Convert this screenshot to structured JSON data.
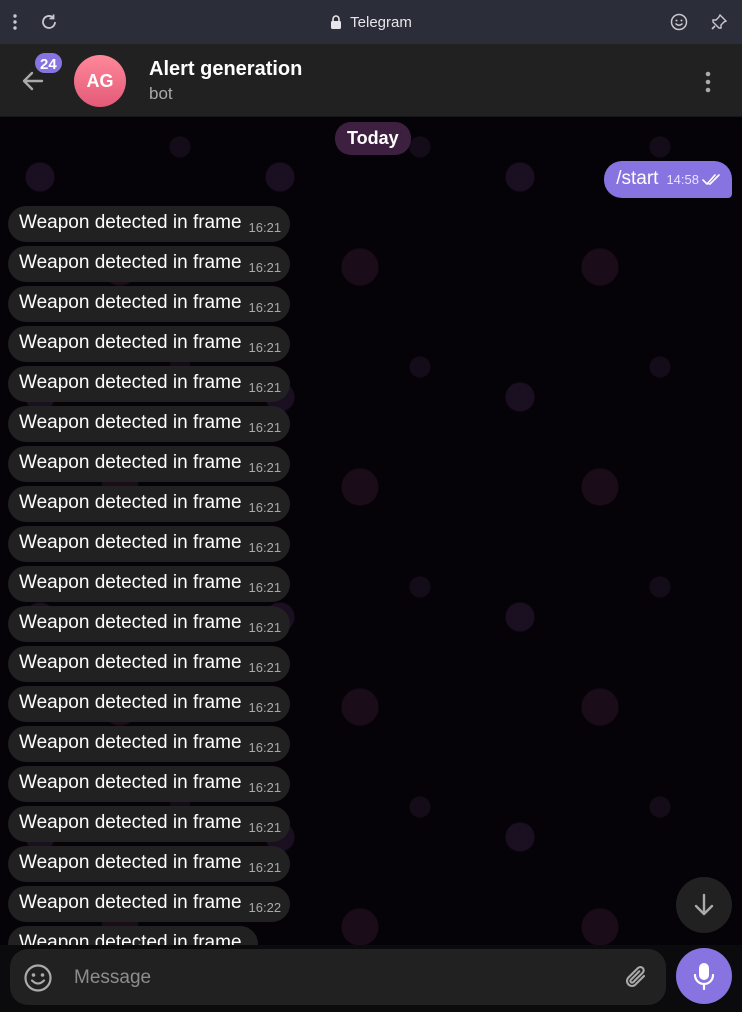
{
  "browser": {
    "title": "Telegram"
  },
  "header": {
    "unread_count": "24",
    "avatar_initials": "AG",
    "title": "Alert generation",
    "subtitle": "bot"
  },
  "chat": {
    "date_separator": "Today",
    "outgoing": {
      "text": "/start",
      "time": "14:58"
    },
    "incoming": [
      {
        "text": "Weapon detected in frame",
        "time": "16:21"
      },
      {
        "text": "Weapon detected in frame",
        "time": "16:21"
      },
      {
        "text": "Weapon detected in frame",
        "time": "16:21"
      },
      {
        "text": "Weapon detected in frame",
        "time": "16:21"
      },
      {
        "text": "Weapon detected in frame",
        "time": "16:21"
      },
      {
        "text": "Weapon detected in frame",
        "time": "16:21"
      },
      {
        "text": "Weapon detected in frame",
        "time": "16:21"
      },
      {
        "text": "Weapon detected in frame",
        "time": "16:21"
      },
      {
        "text": "Weapon detected in frame",
        "time": "16:21"
      },
      {
        "text": "Weapon detected in frame",
        "time": "16:21"
      },
      {
        "text": "Weapon detected in frame",
        "time": "16:21"
      },
      {
        "text": "Weapon detected in frame",
        "time": "16:21"
      },
      {
        "text": "Weapon detected in frame",
        "time": "16:21"
      },
      {
        "text": "Weapon detected in frame",
        "time": "16:21"
      },
      {
        "text": "Weapon detected in frame",
        "time": "16:21"
      },
      {
        "text": "Weapon detected in frame",
        "time": "16:21"
      },
      {
        "text": "Weapon detected in frame",
        "time": "16:21"
      },
      {
        "text": "Weapon detected in frame",
        "time": "16:22"
      },
      {
        "text": "Weapon detected in frame",
        "time": ""
      }
    ]
  },
  "composer": {
    "placeholder": "Message"
  },
  "colors": {
    "accent": "#8774e1",
    "bubble_incoming": "#212121",
    "header_bg": "#212121",
    "date_pill": "#3d2040",
    "avatar_gradient_top": "#ff889a",
    "avatar_gradient_bottom": "#e35a78"
  },
  "icons": {
    "browser_left": [
      "more-vertical-icon",
      "reload-icon"
    ],
    "browser_center": "lock-icon",
    "browser_right": [
      "emoji-icon",
      "pin-icon"
    ],
    "header_left": "back-arrow-icon",
    "header_right": "more-vertical-icon",
    "message_status": "double-check-icon",
    "scroll": "arrow-down-icon",
    "composer": [
      "smiley-icon",
      "paperclip-icon",
      "microphone-icon"
    ]
  }
}
